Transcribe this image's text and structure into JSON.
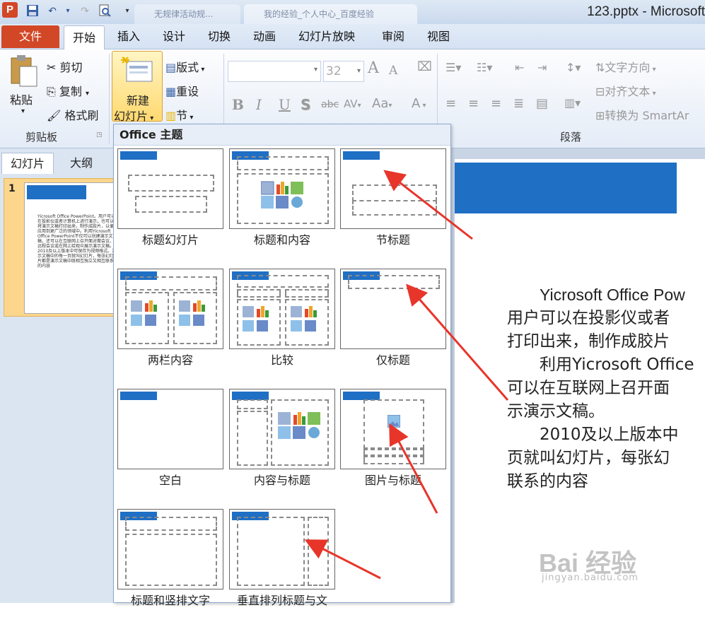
{
  "titlebar": {
    "app_icon_label": "P",
    "browser_tab_1": "无规律活动规...",
    "browser_tab_2": "我的经验_个人中心_百度经验",
    "window_title": "123.pptx - Microsoft"
  },
  "menu": {
    "file": "文件",
    "tabs": [
      "开始",
      "插入",
      "设计",
      "切换",
      "动画",
      "幻灯片放映",
      "审阅",
      "视图"
    ]
  },
  "ribbon": {
    "clipboard": {
      "paste": "粘贴",
      "cut": "剪切",
      "copy": "复制",
      "format_painter": "格式刷",
      "group_label": "剪贴板"
    },
    "slides": {
      "new_slide_line1": "新建",
      "new_slide_line2": "幻灯片",
      "layout": "版式",
      "reset": "重设",
      "section": "节"
    },
    "font": {
      "size": "32",
      "grow": "A",
      "shrink": "A",
      "bold": "B",
      "italic": "I",
      "underline": "U",
      "shadow": "S",
      "strike": "abc",
      "spacing": "AV",
      "case": "Aa",
      "color": "A"
    },
    "paragraph": {
      "text_direction": "文字方向",
      "align_text": "对齐文本",
      "convert_smartart": "转换为 SmartAr",
      "group_label": "段落"
    }
  },
  "left_panel": {
    "tab_slides": "幻灯片",
    "tab_outline": "大纲",
    "slide_number": "1",
    "thumb_text": "Yicrosoft Office PowerPoint。用户可以在投影仪或者计算机上进行演示，也可以将演示文稿打印出来，制作成胶片，以便应用到更广泛的领域中。利用Yicrosoft Office PowerPoint不仅可以创建演示文稿，还可以在互联网上召开面对面会议、远程会议或在网上给观众展示演示文稿。2010及以上版本中可保存为视频格式。演示文稿中的每一页就叫幻灯片，每张幻灯片都是演示文稿中既相互独立又相互联系的内容"
  },
  "dropdown": {
    "header": "Office 主题",
    "layouts": [
      "标题幻灯片",
      "标题和内容",
      "节标题",
      "两栏内容",
      "比较",
      "仅标题",
      "空白",
      "内容与标题",
      "图片与标题",
      "标题和竖排文字",
      "垂直排列标题与文"
    ]
  },
  "slide": {
    "lines": [
      "Yicrosoft Office Pow",
      "用户可以在投影仪或者",
      "打印出来，制作成胶片",
      "利用Yicrosoft Office",
      "可以在互联网上召开面",
      "示演示文稿。",
      "2010及以上版本中",
      "页就叫幻灯片，每张幻",
      "联系的内容"
    ]
  },
  "watermark": {
    "main": "Bai 经验",
    "sub": "jingyan.baidu.com"
  },
  "colors": {
    "accent": "#d24726",
    "slide_blue": "#1f6fc5",
    "arrow": "#e8352a"
  }
}
